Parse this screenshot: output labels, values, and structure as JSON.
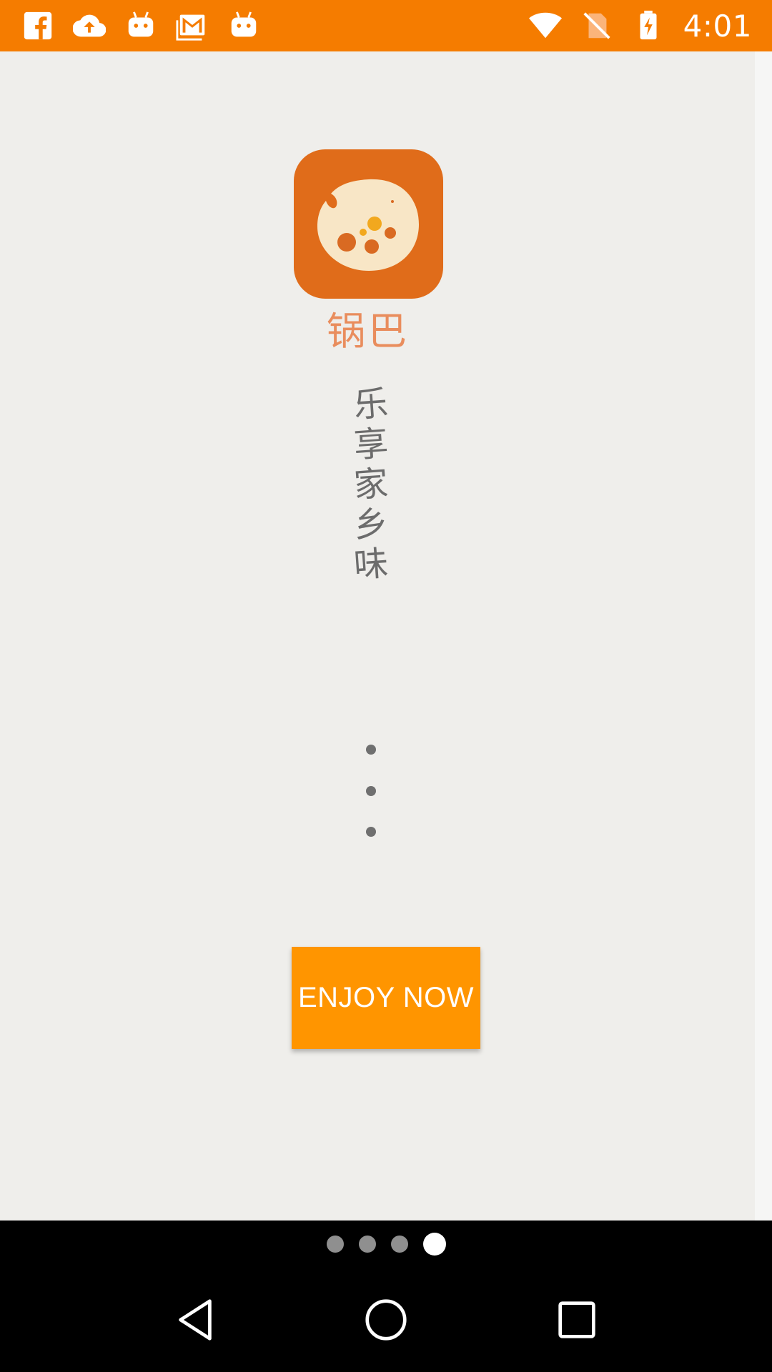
{
  "status_bar": {
    "time": "4:01",
    "left_icons": [
      "facebook-icon",
      "cloud-upload-icon",
      "android-icon",
      "gmail-icon",
      "android-icon"
    ],
    "right_icons": [
      "wifi-icon",
      "no-sim-icon",
      "battery-charging-icon"
    ],
    "background": "#F57C00"
  },
  "app": {
    "brand_name": "锅巴",
    "slogan": [
      "乐",
      "享",
      "家",
      "乡",
      "味"
    ],
    "cta_label": "ENJOY NOW",
    "accent": "#FF9500",
    "logo_color": "#E06C1A"
  },
  "pager": {
    "count": 4,
    "active_index": 3
  },
  "nav_bar": {
    "buttons": [
      "back-icon",
      "home-icon",
      "recents-icon"
    ]
  }
}
